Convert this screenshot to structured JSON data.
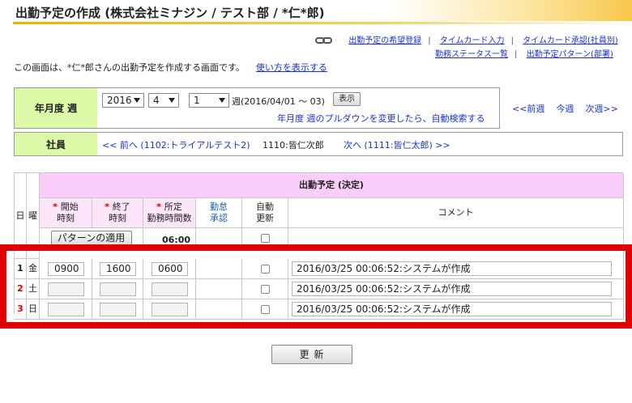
{
  "page": {
    "title": "出勤予定の作成 (株式会社ミナジン / テスト部 / *仁*郎)",
    "links_row1": [
      "出勤予定の希望登録",
      "タイムカード入力",
      "タイムカード承認(社員別)"
    ],
    "links_row2": [
      "勤務ステータス一覧",
      "出勤予定パターン(部署)"
    ],
    "description": "この画面は、*仁*郎さんの出勤予定を作成する画面です。",
    "usage_link": "使い方を表示する"
  },
  "period": {
    "label": "年月度 週",
    "year": "2016",
    "month": "4",
    "week": "1",
    "week_suffix": "週",
    "range": "(2016/04/01 〜 03)",
    "show_button": "表示",
    "hint": "年月度 週のプルダウンを変更したら、自動検索する",
    "nav_prev": "<<前週",
    "nav_this": "今週",
    "nav_next": "次週>>"
  },
  "employee": {
    "label": "社員",
    "prev": "<< 前へ (1102:トライアルテスト2)",
    "current": "1110:皆仁次郎",
    "next": "次へ (1111:皆仁太郎) >>"
  },
  "table": {
    "group_header": "出勤予定 (決定)",
    "col_day": "日",
    "col_weekday": "曜",
    "col_start_label": "開始",
    "col_start_sub": "時刻",
    "col_end_label": "終了",
    "col_end_sub": "時刻",
    "col_work_label": "所定",
    "col_work_sub": "勤務時間数",
    "col_approve1": "勤怠",
    "col_approve2": "承認",
    "col_auto1": "自動",
    "col_auto2": "更新",
    "col_comment": "コメント",
    "pattern_button": "パターンの適用",
    "pattern_work": "06:00",
    "rows": [
      {
        "day": "1",
        "weekday": "金",
        "start": "0900",
        "end": "1600",
        "work": "0600",
        "comment": "2016/03/25 00:06:52:システムが作成"
      },
      {
        "day": "2",
        "weekday": "土",
        "start": "",
        "end": "",
        "work": "",
        "comment": "2016/03/25 00:06:52:システムが作成"
      },
      {
        "day": "3",
        "weekday": "日",
        "start": "",
        "end": "",
        "work": "",
        "comment": "2016/03/25 00:06:52:システムが作成"
      }
    ]
  },
  "update_button": "更 新",
  "colors": {
    "highlight": "#e00000",
    "label_bg": "#dcf9a8",
    "header_pink": "#fbcdfb"
  }
}
